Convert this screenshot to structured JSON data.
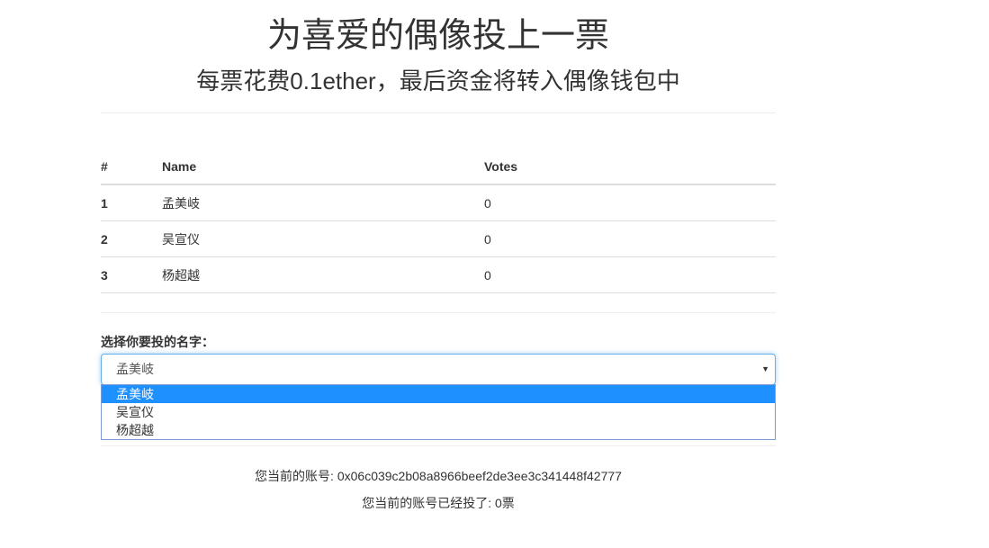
{
  "header": {
    "title": "为喜爱的偶像投上一票",
    "subtitle": "每票花费0.1ether，最后资金将转入偶像钱包中"
  },
  "table": {
    "columns": [
      "#",
      "Name",
      "Votes"
    ],
    "rows": [
      {
        "id": "1",
        "name": "孟美岐",
        "votes": "0"
      },
      {
        "id": "2",
        "name": "吴宣仪",
        "votes": "0"
      },
      {
        "id": "3",
        "name": "杨超越",
        "votes": "0"
      }
    ]
  },
  "vote_form": {
    "label": "选择你要投的名字：",
    "selected_value": "孟美岐",
    "caret": "▼",
    "options": [
      "孟美岐",
      "吴宣仪",
      "杨超越"
    ],
    "highlighted_option": "孟美岐"
  },
  "account": {
    "address_line": "您当前的账号: 0x06c039c2b08a8966beef2de3ee3c341448f42777",
    "votes_line": "您当前的账号已经投了: 0票"
  },
  "colors": {
    "highlight": "#1e90ff",
    "focus_border": "#66afe9",
    "divider": "#eeeeee",
    "text": "#333333"
  }
}
